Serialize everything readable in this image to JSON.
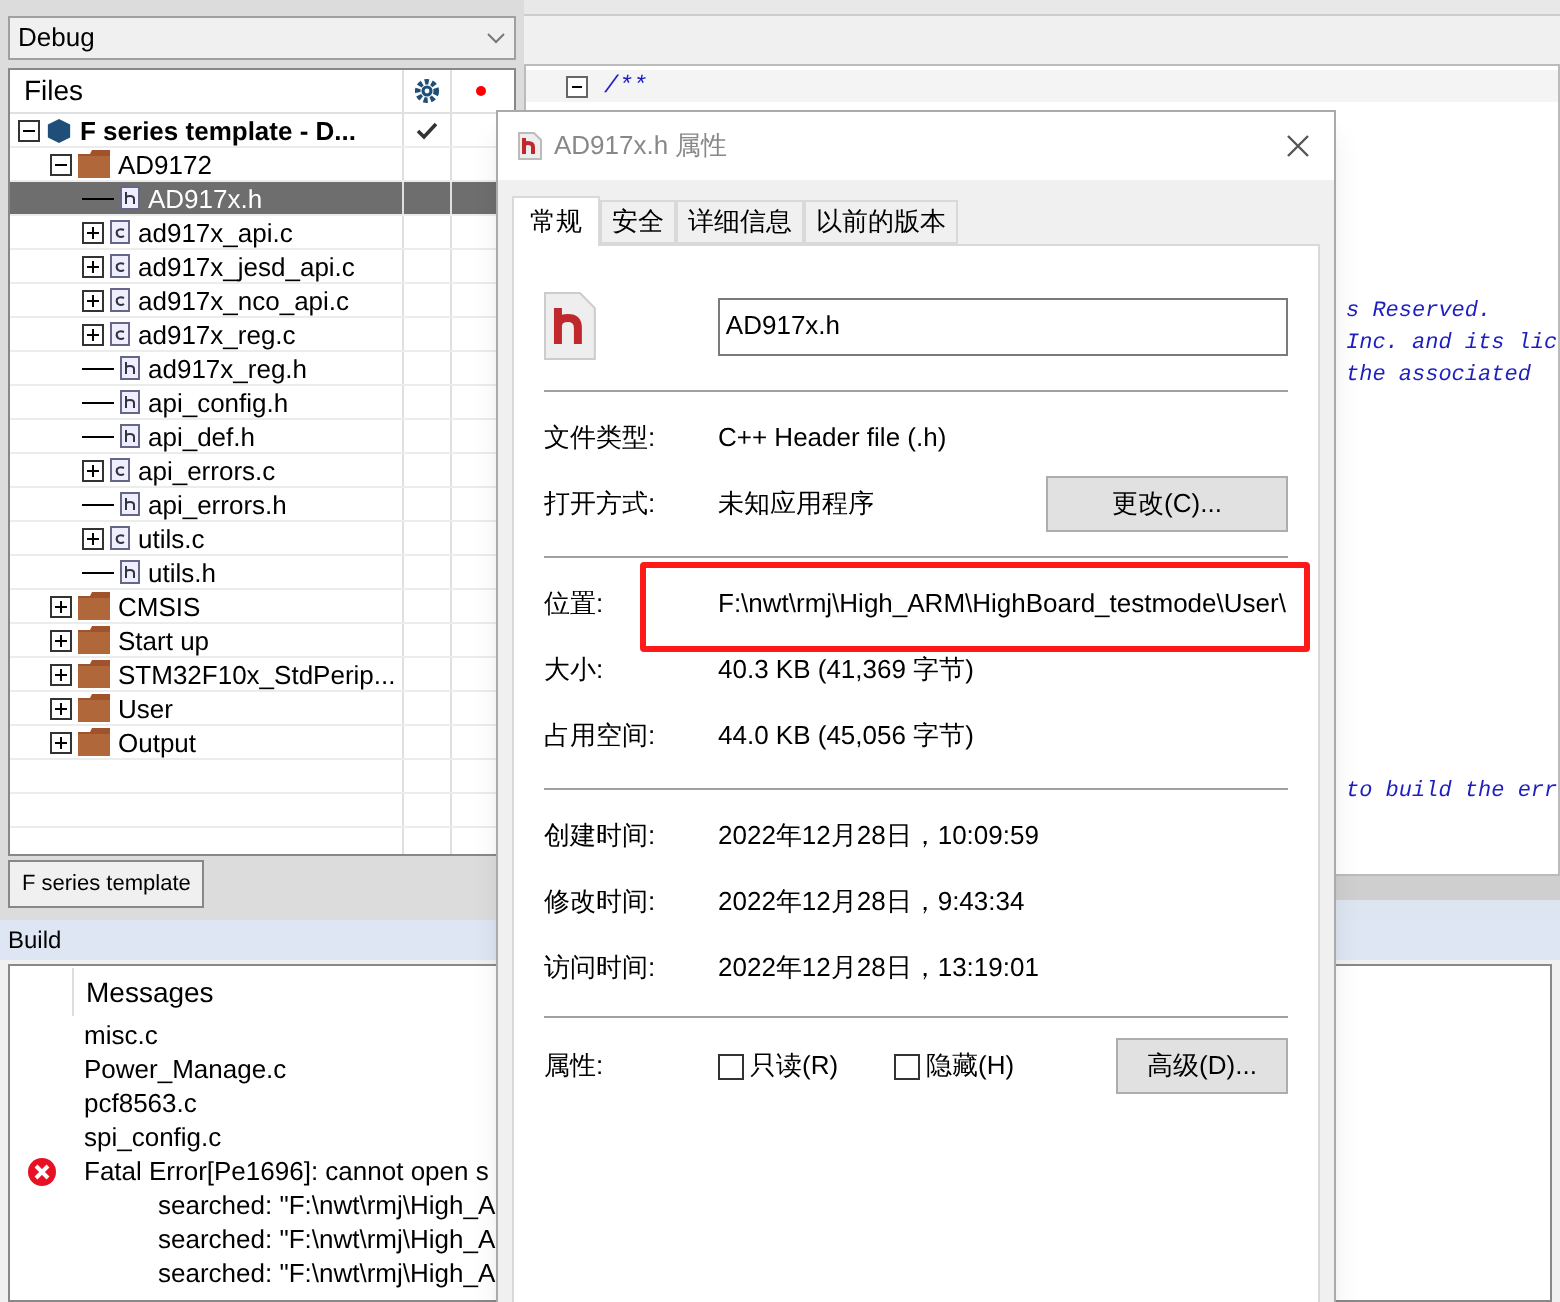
{
  "workspace": {
    "config": "Debug",
    "files_header": "Files",
    "tree": [
      {
        "label": "F series template - D...",
        "kind": "project",
        "expanded": true,
        "checked": true,
        "selected": false,
        "children": [
          {
            "label": "AD9172",
            "kind": "folder",
            "expanded": true,
            "selected": false,
            "children": [
              {
                "label": "AD917x.h",
                "kind": "h",
                "selected": true
              },
              {
                "label": "ad917x_api.c",
                "kind": "c",
                "expanded": false,
                "selected": false
              },
              {
                "label": "ad917x_jesd_api.c",
                "kind": "c",
                "expanded": false,
                "selected": false
              },
              {
                "label": "ad917x_nco_api.c",
                "kind": "c",
                "expanded": false,
                "selected": false
              },
              {
                "label": "ad917x_reg.c",
                "kind": "c",
                "expanded": false,
                "selected": false
              },
              {
                "label": "ad917x_reg.h",
                "kind": "h",
                "selected": false
              },
              {
                "label": "api_config.h",
                "kind": "h",
                "selected": false
              },
              {
                "label": "api_def.h",
                "kind": "h",
                "selected": false
              },
              {
                "label": "api_errors.c",
                "kind": "c",
                "expanded": false,
                "selected": false
              },
              {
                "label": "api_errors.h",
                "kind": "h",
                "selected": false
              },
              {
                "label": "utils.c",
                "kind": "c",
                "expanded": false,
                "selected": false
              },
              {
                "label": "utils.h",
                "kind": "h",
                "selected": false
              }
            ]
          },
          {
            "label": "CMSIS",
            "kind": "folder",
            "expanded": false,
            "selected": false
          },
          {
            "label": "Start up",
            "kind": "folder",
            "expanded": false,
            "selected": false
          },
          {
            "label": "STM32F10x_StdPerip...",
            "kind": "folder",
            "expanded": false,
            "selected": false
          },
          {
            "label": "User",
            "kind": "folder",
            "expanded": false,
            "selected": false
          },
          {
            "label": "Output",
            "kind": "folder",
            "expanded": false,
            "selected": false
          }
        ]
      }
    ],
    "bottom_tab": "F series template"
  },
  "editor": {
    "first_line": "/**",
    "fragments": [
      "s Reserved.",
      "Inc. and its lic",
      "the associated"
    ],
    "lower_fragment": "to build the err"
  },
  "build": {
    "title": "Build",
    "column": "Messages",
    "messages": [
      {
        "kind": "file",
        "text": "misc.c"
      },
      {
        "kind": "file",
        "text": "Power_Manage.c"
      },
      {
        "kind": "file",
        "text": "pcf8563.c"
      },
      {
        "kind": "file",
        "text": "spi_config.c"
      },
      {
        "kind": "error",
        "text": "Fatal Error[Pe1696]: cannot open s"
      },
      {
        "kind": "detail",
        "text": "searched: \"F:\\nwt\\rmj\\High_A"
      },
      {
        "kind": "detail",
        "text": "searched: \"F:\\nwt\\rmj\\High_A"
      },
      {
        "kind": "detail",
        "text": "searched: \"F:\\nwt\\rmj\\High_A"
      }
    ]
  },
  "dialog": {
    "title": "AD917x.h 属性",
    "tabs": [
      {
        "label": "常规",
        "selected": true
      },
      {
        "label": "安全",
        "selected": false
      },
      {
        "label": "详细信息",
        "selected": false
      },
      {
        "label": "以前的版本",
        "selected": false
      }
    ],
    "file_name": "AD917x.h",
    "groups": [
      [
        {
          "label": "文件类型:",
          "value": "C++ Header file (.h)"
        },
        {
          "label": "打开方式:",
          "value": "未知应用程序",
          "button": "更改(C)..."
        }
      ],
      [
        {
          "label": "位置:",
          "value": "F:\\nwt\\rmj\\High_ARM\\HighBoard_testmode\\User\\",
          "highlighted": true
        },
        {
          "label": "大小:",
          "value": "40.3 KB (41,369 字节)",
          "highlighted": false
        },
        {
          "label": "占用空间:",
          "value": "44.0 KB (45,056 字节)",
          "highlighted": false
        }
      ],
      [
        {
          "label": "创建时间:",
          "value": "2022年12月28日，10:09:59"
        },
        {
          "label": "修改时间:",
          "value": "2022年12月28日，9:43:34"
        },
        {
          "label": "访问时间:",
          "value": "2022年12月28日，13:19:01"
        }
      ]
    ],
    "attributes": {
      "label": "属性:",
      "checkboxes": [
        {
          "label": "只读(R)",
          "checked": false
        },
        {
          "label": "隐藏(H)",
          "checked": false
        }
      ],
      "button": "高级(D)..."
    }
  }
}
